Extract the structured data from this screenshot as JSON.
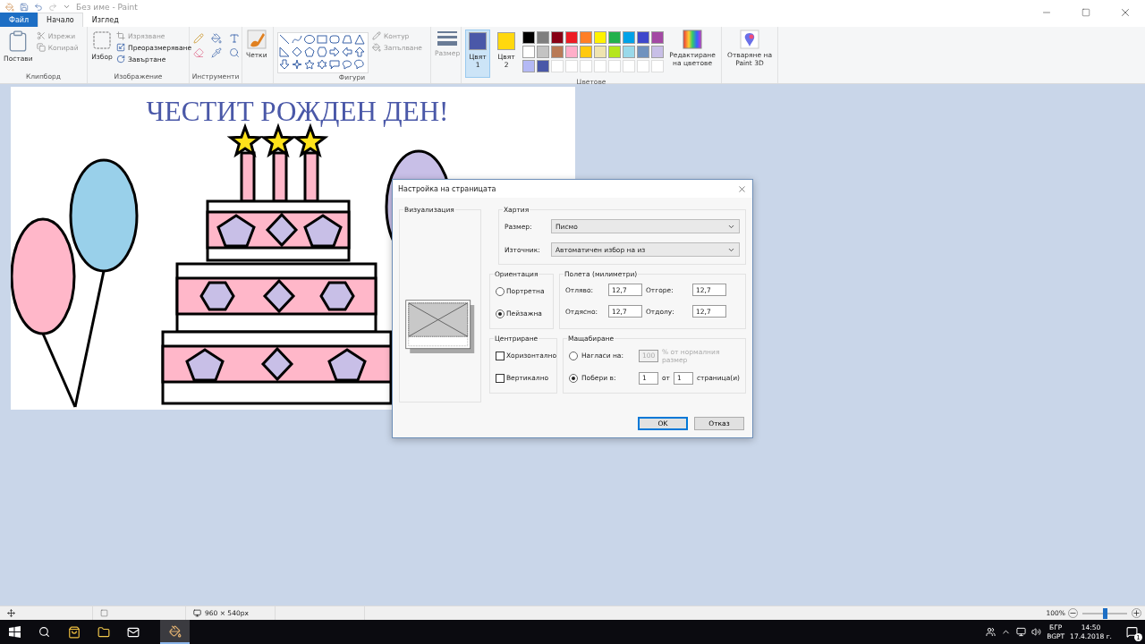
{
  "window": {
    "title": "Без име - Paint"
  },
  "menu_tabs": [
    {
      "label": "Файл",
      "kind": "file",
      "selected": false
    },
    {
      "label": "Начало",
      "kind": "tab",
      "selected": true
    },
    {
      "label": "Изглед",
      "kind": "tab",
      "selected": false
    }
  ],
  "ribbon": {
    "clipboard": {
      "paste": "Постави",
      "cut": "Изрежи",
      "copy": "Копирай",
      "group": "Клипборд"
    },
    "image": {
      "select": "Избор",
      "crop": "Изрязване",
      "resize": "Преоразмеряване",
      "rotate": "Завъртане",
      "group": "Изображение"
    },
    "tools": {
      "group": "Инструменти"
    },
    "brushes": "Четки",
    "shapes": {
      "outline": "Контур",
      "fill": "Запълване",
      "group": "Фигури"
    },
    "size": "Размер",
    "color_slots": [
      {
        "label": "Цвят 1",
        "color": "#4a58a8",
        "selected": true
      },
      {
        "label": "Цвят 2",
        "color": "#ffd80e",
        "selected": false
      }
    ],
    "palette": [
      {
        "color": "#000000"
      },
      {
        "color": "#7f7f7f"
      },
      {
        "color": "#880015"
      },
      {
        "color": "#ed1c24"
      },
      {
        "color": "#ff7f27"
      },
      {
        "color": "#fff200"
      },
      {
        "color": "#22b14c"
      },
      {
        "color": "#00a2e8"
      },
      {
        "color": "#3f48cc"
      },
      {
        "color": "#a349a4"
      },
      {
        "color": "#ffffff"
      },
      {
        "color": "#c3c3c3"
      },
      {
        "color": "#b97a57"
      },
      {
        "color": "#ffaec9"
      },
      {
        "color": "#ffc90e"
      },
      {
        "color": "#efe4b0"
      },
      {
        "color": "#b5e61d"
      },
      {
        "color": "#99d9ea"
      },
      {
        "color": "#7092be"
      },
      {
        "color": "#c8bfe7"
      },
      {
        "color": "#b4b9f5"
      },
      {
        "color": "#4a58a8"
      }
    ],
    "edit_colors": "Редактиране на цветове",
    "colors_group": "Цветове",
    "paint3d": "Отваряне на Paint 3D"
  },
  "canvas": {
    "text": "ЧЕСТИТ РОЖДЕН ДЕН!"
  },
  "dialog": {
    "title": "Настройка на страницата",
    "preview": "Визуализация",
    "paper": {
      "title": "Хартия",
      "size_label": "Размер:",
      "size_value": "Писмо",
      "source_label": "Източник:",
      "source_value": "Автоматичен избор на из"
    },
    "orientation": {
      "title": "Ориентация",
      "options": [
        {
          "label": "Портретна",
          "selected": false
        },
        {
          "label": "Пейзажна",
          "selected": true
        }
      ]
    },
    "margins": {
      "title": "Полета (милиметри)",
      "fields": [
        {
          "label": "Отляво:",
          "value": "12,7"
        },
        {
          "label": "Отгоре:",
          "value": "12,7"
        },
        {
          "label": "Отдясно:",
          "value": "12,7"
        },
        {
          "label": "Отдолу:",
          "value": "12,7"
        }
      ]
    },
    "centering": {
      "title": "Центриране",
      "options": [
        {
          "label": "Хоризонтално",
          "checked": false
        },
        {
          "label": "Вертикално",
          "checked": false
        }
      ]
    },
    "scaling": {
      "title": "Мащабиране",
      "adjust": {
        "label": "Нагласи на:",
        "selected": false,
        "value": "100",
        "disabled": true,
        "suffix": "% от нормалния размер"
      },
      "fit": {
        "label": "Побери в:",
        "selected": true,
        "value1": "1",
        "of": "от",
        "value2": "1",
        "suffix": "страница(и)"
      }
    },
    "buttons": [
      {
        "label": "OK",
        "kind": "default"
      },
      {
        "label": "Отказ",
        "kind": "normal"
      }
    ]
  },
  "status_bar": {
    "size": "960 × 540px",
    "zoom": "100%",
    "zoom_level": {
      "level": 0.5
    }
  },
  "taskbar": {
    "lang": "БГР",
    "layout": "BGPT",
    "time": "14:50",
    "date": "17.4.2018 г.",
    "notifications": "1"
  }
}
